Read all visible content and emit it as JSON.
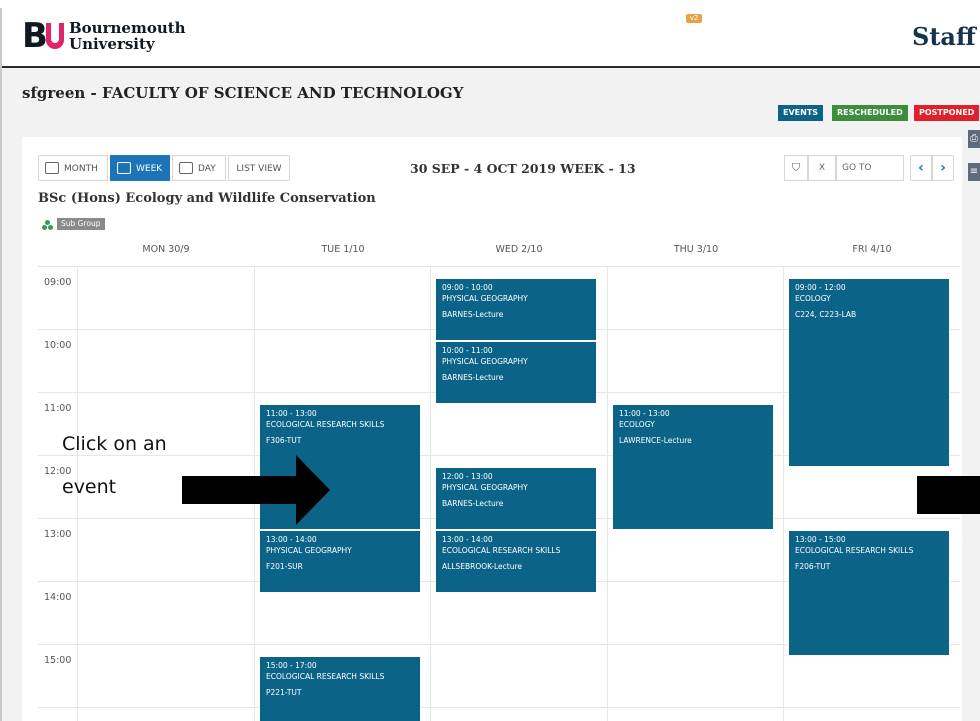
{
  "header": {
    "logo_mark": "BU",
    "logo_line1": "Bournemouth",
    "logo_line2": "University",
    "top_badge": "v2",
    "portal_label": "Staff"
  },
  "page": {
    "faculty_title": "sfgreen - FACULTY OF SCIENCE AND TECHNOLOGY"
  },
  "legend": [
    {
      "label": "EVENTS",
      "color": "#0b6488"
    },
    {
      "label": "RESCHEDULED",
      "color": "#3c8d3c"
    },
    {
      "label": "POSTPONED",
      "color": "#e0202a"
    }
  ],
  "toolbar": {
    "month_label": "MONTH",
    "week_label": "WEEK",
    "day_label": "DAY",
    "list_label": "LIST VIEW",
    "active_view": "WEEK",
    "week_title": "30 SEP - 4 OCT 2019 WEEK - 13",
    "filter_icon": "filter-icon",
    "clear_label": "X",
    "goto_label": "GO TO",
    "prev_label": "‹",
    "next_label": "›"
  },
  "course": {
    "title": "BSc (Hons) Ecology and Wildlife Conservation",
    "subgroup_label": "Sub Group"
  },
  "days": [
    "MON 30/9",
    "TUE 1/10",
    "WED 2/10",
    "THU 3/10",
    "FRI 4/10"
  ],
  "times": [
    "09:00",
    "10:00",
    "11:00",
    "12:00",
    "13:00",
    "14:00",
    "15:00"
  ],
  "events": [
    {
      "day": 2,
      "start": 9,
      "end": 10,
      "time": "09:00 - 10:00",
      "title": "PHYSICAL GEOGRAPHY",
      "location": "BARNES-Lecture"
    },
    {
      "day": 2,
      "start": 10,
      "end": 11,
      "time": "10:00 - 11:00",
      "title": "PHYSICAL GEOGRAPHY",
      "location": "BARNES-Lecture"
    },
    {
      "day": 4,
      "start": 9,
      "end": 12,
      "time": "09:00 - 12:00",
      "title": "ECOLOGY",
      "location": "C224, C223-LAB"
    },
    {
      "day": 1,
      "start": 11,
      "end": 13,
      "time": "11:00 - 13:00",
      "title": "ECOLOGICAL RESEARCH SKILLS",
      "location": "F306-TUT"
    },
    {
      "day": 3,
      "start": 11,
      "end": 13,
      "time": "11:00 - 13:00",
      "title": "ECOLOGY",
      "location": "LAWRENCE-Lecture"
    },
    {
      "day": 2,
      "start": 12,
      "end": 13,
      "time": "12:00 - 13:00",
      "title": "PHYSICAL GEOGRAPHY",
      "location": "BARNES-Lecture"
    },
    {
      "day": 1,
      "start": 13,
      "end": 14,
      "time": "13:00 - 14:00",
      "title": "PHYSICAL GEOGRAPHY",
      "location": "F201-SUR"
    },
    {
      "day": 2,
      "start": 13,
      "end": 14,
      "time": "13:00 - 14:00",
      "title": "ECOLOGICAL RESEARCH SKILLS",
      "location": "ALLSEBROOK-Lecture"
    },
    {
      "day": 4,
      "start": 13,
      "end": 15,
      "time": "13:00 - 15:00",
      "title": "ECOLOGICAL RESEARCH SKILLS",
      "location": "F206-TUT"
    },
    {
      "day": 1,
      "start": 15,
      "end": 17,
      "time": "15:00 - 17:00",
      "title": "ECOLOGICAL RESEARCH SKILLS",
      "location": "P221-TUT"
    }
  ],
  "annotation": {
    "line1": "Click on an",
    "line2": "event"
  }
}
